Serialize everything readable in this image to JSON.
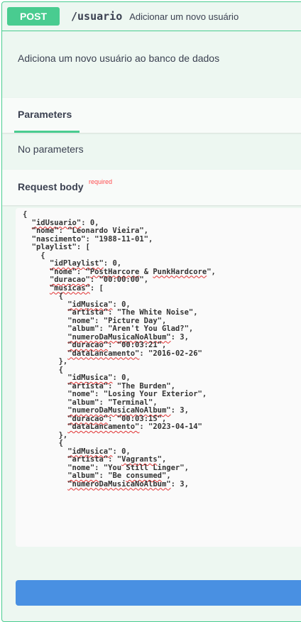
{
  "operation": {
    "method": "POST",
    "path": "/usuario",
    "summary": "Adicionar um novo usuário",
    "description": "Adiciona um novo usuário ao banco de dados"
  },
  "parameters": {
    "tab_label": "Parameters",
    "empty_text": "No parameters"
  },
  "request_body": {
    "title": "Request body",
    "required_label": "required",
    "json_lines": [
      [
        "{"
      ],
      [
        "  ",
        {
          "k": "\"idUsuario\""
        },
        ": 0,"
      ],
      [
        "  \"nome\": \"Leonardo Vieira\","
      ],
      [
        "  \"nascimento\": \"1988-11-01\","
      ],
      [
        "  \"playlist\": ["
      ],
      [
        "    {"
      ],
      [
        "      ",
        {
          "k": "\"idPlaylist\""
        },
        ": 0,"
      ],
      [
        "      \"nome\": \"",
        {
          "k": "PostHarcore"
        },
        " & ",
        {
          "k": "PunkHardcore"
        },
        "\","
      ],
      [
        "      ",
        {
          "k": "\"duracao\""
        },
        ": \"00:00:00\","
      ],
      [
        "      ",
        {
          "k": "\"musicas\""
        },
        ": ["
      ],
      [
        "        {"
      ],
      [
        "          ",
        {
          "k": "\"idMusica\""
        },
        ": 0,"
      ],
      [
        "          \"artista\": \"The White Noise\","
      ],
      [
        "          \"nome\": \"Picture Day\","
      ],
      [
        "          \"album\": \"Aren't You Glad?\","
      ],
      [
        "          ",
        {
          "k": "\"numeroDaMusicaNoAlbum\""
        },
        ": 3,"
      ],
      [
        "          ",
        {
          "k": "\"duracao\""
        },
        ": \"00:03:21\","
      ],
      [
        "          ",
        {
          "k": "\"dataLancamento\""
        },
        ": \"2016-02-26\""
      ],
      [
        "        },"
      ],
      [
        "        {"
      ],
      [
        "          ",
        {
          "k": "\"idMusica\""
        },
        ": 0,"
      ],
      [
        "          \"artista\": \"The Burden\","
      ],
      [
        "          \"nome\": \"Losing Your Exterior\","
      ],
      [
        "          \"album\": \"Terminal\","
      ],
      [
        "          ",
        {
          "k": "\"numeroDaMusicaNoAlbum\""
        },
        ": 3,"
      ],
      [
        "          ",
        {
          "k": "\"duracao\""
        },
        ": \"00:03:15\","
      ],
      [
        "          ",
        {
          "k": "\"dataLancamento\""
        },
        ": \"2023-04-14\""
      ],
      [
        "        },"
      ],
      [
        "        {"
      ],
      [
        "          ",
        {
          "k": "\"idMusica\""
        },
        ": 0,"
      ],
      [
        "          \"artista\": \"",
        {
          "k": "Vagrants"
        },
        "\","
      ],
      [
        "          \"nome\": \"You Still Linger\","
      ],
      [
        "          ",
        {
          "k": "\"album\""
        },
        ": \"Be ",
        {
          "k": "consumed"
        },
        "\","
      ],
      [
        "          ",
        {
          "k": "\"numeroDaMusicaNoAlbum\""
        },
        ": 3,"
      ]
    ]
  },
  "colors": {
    "post_green": "#49cc90",
    "block_bg": "#edf7f1",
    "execute_blue": "#4990e2",
    "required_red": "#ff4d4f"
  }
}
